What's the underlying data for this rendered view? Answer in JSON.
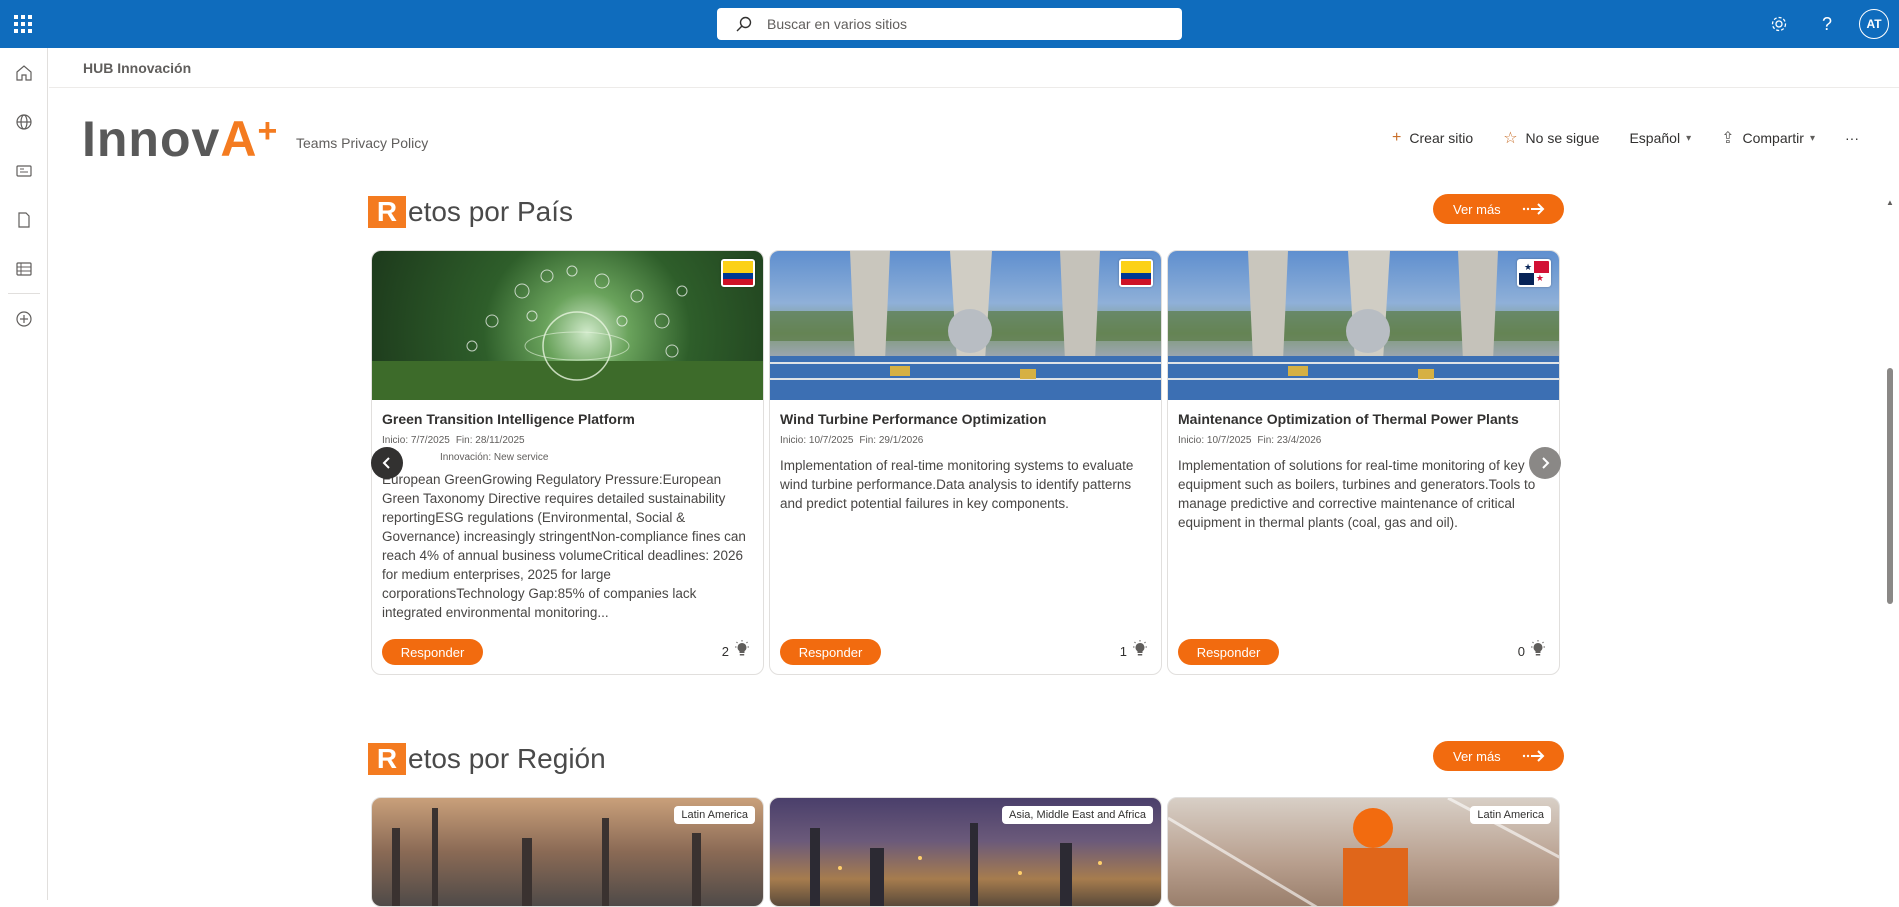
{
  "suite": {
    "search_placeholder": "Buscar en varios sitios",
    "avatar_initials": "AT",
    "accent": "#0f6cbd"
  },
  "hub": {
    "name": "HUB Innovación"
  },
  "site": {
    "logo_main": "Innov",
    "logo_accent": "A",
    "logo_plus": "+",
    "nav_link": "Teams Privacy Policy"
  },
  "commands": {
    "create_site": "Crear sitio",
    "follow": "No se sigue",
    "language": "Español",
    "share": "Compartir",
    "more": "···"
  },
  "sections": {
    "country": {
      "title_initial": "R",
      "title_rest": "etos por País",
      "more_label": "Ver más"
    },
    "region": {
      "title_initial": "R",
      "title_rest": "etos por Región",
      "more_label": "Ver más"
    }
  },
  "country_cards": [
    {
      "title": "Green Transition Intelligence Platform",
      "start": "Inicio: 7/7/2025",
      "end": "Fin: 28/11/2025",
      "innovation": "Innovación: New service",
      "description": "European GreenGrowing Regulatory Pressure:European Green Taxonomy Directive requires detailed sustainability reportingESG regulations (Environmental, Social & Governance) increasingly stringentNon-compliance fines can reach 4% of annual business volumeCritical deadlines: 2026 for medium enterprises, 2025 for large corporationsTechnology Gap:85% of companies lack integrated environmental monitoring...",
      "respond_label": "Responder",
      "ideas": "2",
      "flag": "colombia-flag"
    },
    {
      "title": "Wind Turbine Performance Optimization",
      "start": "Inicio: 10/7/2025",
      "end": "Fin: 29/1/2026",
      "description": "Implementation of real-time monitoring systems to evaluate wind turbine performance.Data analysis to identify patterns and predict potential failures in key components.",
      "respond_label": "Responder",
      "ideas": "1",
      "flag": "colombia-flag"
    },
    {
      "title": "Maintenance Optimization of Thermal Power Plants",
      "start": "Inicio: 10/7/2025",
      "end": "Fin: 23/4/2026",
      "description": "Implementation of solutions for real-time monitoring of key equipment such as boilers, turbines and generators.Tools to manage predictive and corrective maintenance of critical equipment in thermal plants (coal, gas and oil).",
      "respond_label": "Responder",
      "ideas": "0",
      "flag": "panama-flag"
    }
  ],
  "region_cards": [
    {
      "region": "Latin America"
    },
    {
      "region": "Asia, Middle East and Africa"
    },
    {
      "region": "Latin America"
    }
  ],
  "colors": {
    "brand_orange": "#f26b0f",
    "logo_gray": "#595959"
  }
}
